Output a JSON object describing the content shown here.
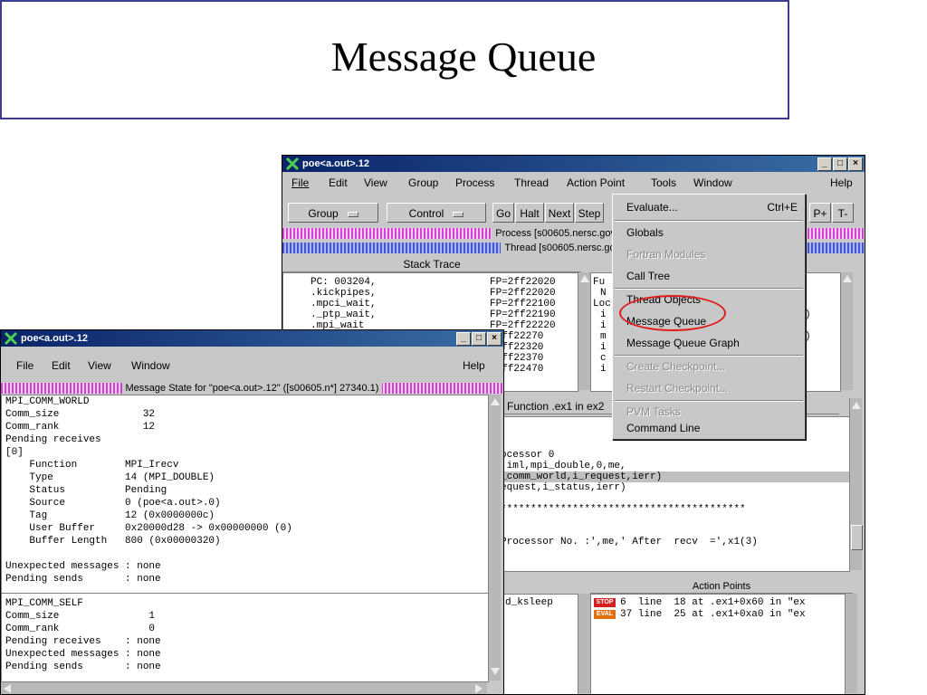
{
  "slide": {
    "title": "Message Queue"
  },
  "bg_window": {
    "title": "poe<a.out>.12",
    "menu": [
      "File",
      "Edit",
      "View",
      "Group",
      "Process",
      "Thread",
      "Action Point",
      "Tools",
      "Window",
      "Help"
    ],
    "toolbar": {
      "group": "Group",
      "control": "Control",
      "go": "Go",
      "halt": "Halt",
      "next": "Next",
      "step": "Step",
      "pplus": "P+",
      "tminus": "T-"
    },
    "process_bar": "Process [s00605.nersc.gov] 27340:",
    "thread_bar": "Thread [s00605.nersc.gov] 273",
    "stack_trace_header": "Stack Trace",
    "stack_trace": [
      {
        "fn": "PC: 003204,",
        "fp": "FP=2ff22020"
      },
      {
        "fn": ".kickpipes,",
        "fp": "FP=2ff22020"
      },
      {
        "fn": ".mpci_wait,",
        "fp": "FP=2ff22100"
      },
      {
        "fn": "._ptp_wait,",
        "fp": "FP=2ff22190"
      },
      {
        "fn": ".mpi_wait",
        "fp": "FP=2ff22220"
      },
      {
        "fn": "",
        "fp": "=2ff22270"
      },
      {
        "fn": "",
        "fp": "=2ff22320"
      },
      {
        "fn": "",
        "fp": "=2ff22370"
      },
      {
        "fn": "",
        "fp": "=2ff22470"
      }
    ],
    "frame_text": [
      "Fu",
      "N",
      "Loc",
      "i",
      "i",
      "m",
      "i",
      "c",
      "i"
    ],
    "frame_right": [
      ")",
      ")"
    ],
    "source_header": "Function .ex1 in ex2",
    "source_lines": [
      "ocessor 0",
      ".iml,mpi_double,0,me,",
      "_comm_world,i_request,ierr)",
      "equest,i_status,ierr)",
      "",
      "*****************************************",
      "",
      "",
      "Processor No. :',me,' After  recv  =',x1(3)"
    ],
    "action_points_header": "Action Points",
    "thread_list": [
      "d_ksleep"
    ],
    "action_points": [
      {
        "badge": "STOP",
        "badge_color": "#d42020",
        "text": "6  line  18 at .ex1+0x60 in \"ex"
      },
      {
        "badge": "EVAL",
        "badge_color": "#e07010",
        "text": "37 line  25 at .ex1+0xa0 in \"ex"
      }
    ]
  },
  "tools_menu": {
    "items": [
      {
        "label": "Evaluate...",
        "shortcut": "Ctrl+E",
        "disabled": false
      },
      {
        "label": "Globals",
        "disabled": false
      },
      {
        "label": "Fortran Modules",
        "disabled": true
      },
      {
        "label": "Call Tree",
        "disabled": false
      },
      {
        "label": "Thread Objects",
        "disabled": false
      },
      {
        "label": "Message Queue",
        "disabled": false
      },
      {
        "label": "Message Queue Graph",
        "disabled": false
      },
      {
        "label": "Create Checkpoint...",
        "disabled": true
      },
      {
        "label": "Restart Checkpoint...",
        "disabled": true
      },
      {
        "label": "PVM Tasks",
        "disabled": true
      },
      {
        "label": "Command Line",
        "disabled": false
      }
    ],
    "highlight_color": "#e21b1b"
  },
  "mq_window": {
    "title": "poe<a.out>.12",
    "menu": [
      "File",
      "Edit",
      "View",
      "Window",
      "Help"
    ],
    "state_bar": "Message State for \"poe<a.out>.12\" ([s00605.n*] 27340.1)",
    "lines": [
      "MPI_COMM_WORLD",
      "Comm_size              32",
      "Comm_rank              12",
      "Pending receives",
      "[0]",
      "    Function        MPI_Irecv",
      "    Type            14 (MPI_DOUBLE)",
      "    Status          Pending",
      "    Source          0 (poe<a.out>.0)",
      "    Tag             12 (0x0000000c)",
      "    User Buffer     0x20000d28 -> 0x00000000 (0)",
      "    Buffer Length   800 (0x00000320)",
      "",
      "Unexpected messages : none",
      "Pending sends       : none"
    ],
    "lines2": [
      "MPI_COMM_SELF",
      "Comm_size               1",
      "Comm_rank               0",
      "Pending receives    : none",
      "Unexpected messages : none",
      "Pending sends       : none"
    ]
  }
}
